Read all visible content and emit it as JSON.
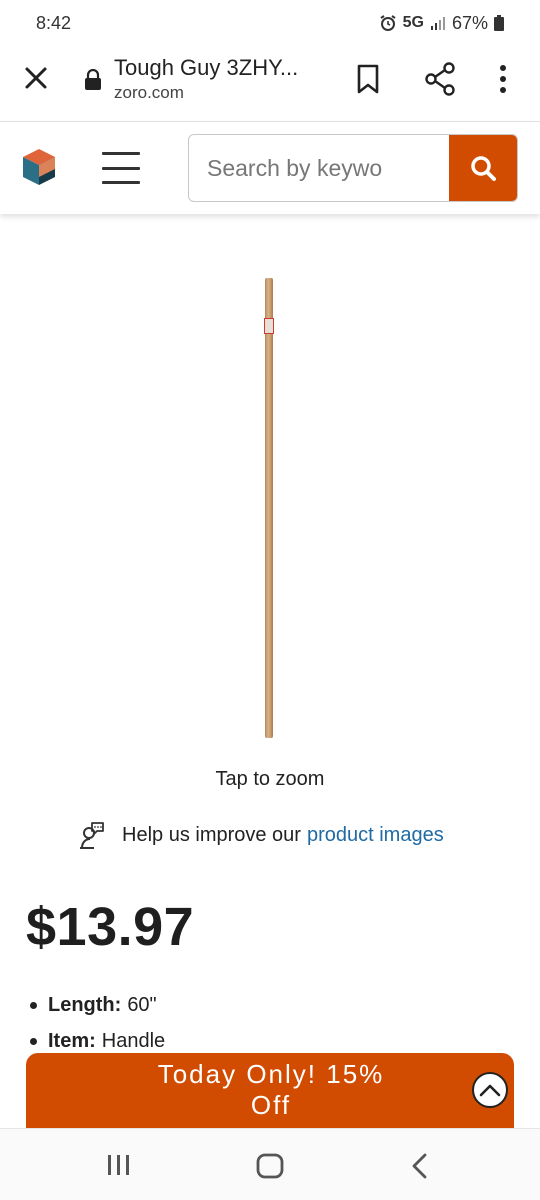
{
  "status": {
    "time": "8:42",
    "network": "5G",
    "battery": "67%"
  },
  "browser": {
    "page_title": "Tough Guy 3ZHY...",
    "url": "zoro.com"
  },
  "header": {
    "search_placeholder": "Search by keywo"
  },
  "product": {
    "tap_to_zoom": "Tap to zoom",
    "help_text": "Help us improve our",
    "help_link": "product images",
    "price": "$13.97",
    "specs": [
      {
        "label": "Length:",
        "value": "60\""
      },
      {
        "label": "Item:",
        "value": "Handle"
      }
    ]
  },
  "promo": {
    "text": "Today Only! 15% Off"
  },
  "colors": {
    "accent": "#d14b00",
    "link": "#1f6aa5"
  }
}
